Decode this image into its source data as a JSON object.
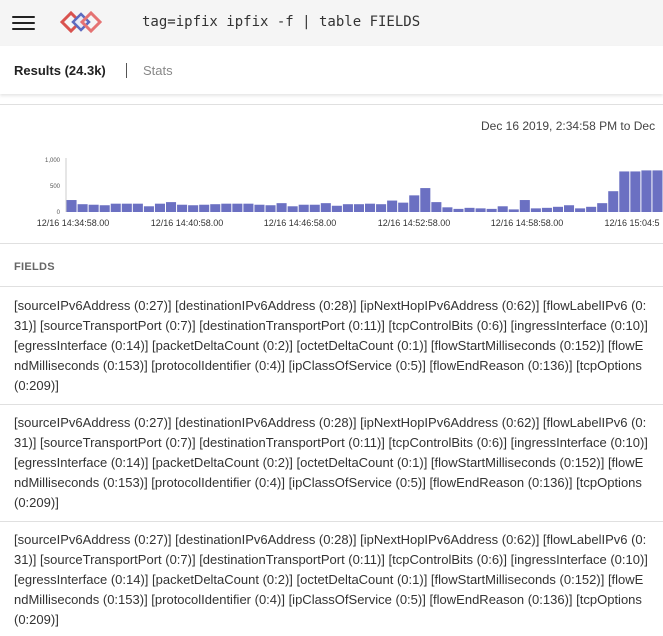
{
  "query": "tag=ipfix ipfix -f | table FIELDS",
  "tabs": {
    "results": "Results (24.3k)",
    "stats": "Stats"
  },
  "histogram": {
    "range_text": "Dec 16 2019, 2:34:58 PM to Dec",
    "y_ticks": [
      "1,000",
      "500",
      "0"
    ],
    "x_labels": [
      "12/16 14:34:58.00",
      "12/16 14:40:58.00",
      "12/16 14:46:58.00",
      "12/16 14:52:58.00",
      "12/16 14:58:58.00",
      "12/16 15:04:5"
    ],
    "bar_color": "#6b70c2"
  },
  "chart_data": {
    "type": "bar",
    "ylim": [
      0,
      1000
    ],
    "y_ticks": [
      0,
      500,
      1000
    ],
    "values": [
      230,
      150,
      140,
      130,
      160,
      160,
      160,
      110,
      160,
      190,
      140,
      130,
      140,
      150,
      160,
      160,
      160,
      140,
      130,
      170,
      110,
      140,
      140,
      170,
      120,
      150,
      150,
      160,
      150,
      220,
      180,
      320,
      460,
      190,
      90,
      60,
      80,
      70,
      60,
      110,
      50,
      230,
      70,
      80,
      100,
      130,
      70,
      100,
      170,
      400,
      780,
      780,
      800,
      800
    ],
    "x_labels": [
      "12/16 14:34:58.00",
      "12/16 14:40:58.00",
      "12/16 14:46:58.00",
      "12/16 14:52:58.00",
      "12/16 14:58:58.00",
      "12/16 15:04:5"
    ]
  },
  "fields": {
    "header": "FIELDS",
    "rows": [
      "[sourceIPv6Address (0:27)] [destinationIPv6Address (0:28)] [ipNextHopIPv6Address (0:62)] [flowLabelIPv6 (0:31)] [sourceTransportPort (0:7)] [destinationTransportPort (0:11)] [tcpControlBits (0:6)] [ingressInterface (0:10)] [egressInterface (0:14)] [packetDeltaCount (0:2)] [octetDeltaCount (0:1)] [flowStartMilliseconds (0:152)] [flowEndMilliseconds (0:153)] [protocolIdentifier (0:4)] [ipClassOfService (0:5)] [flowEndReason (0:136)] [tcpOptions (0:209)]",
      "[sourceIPv6Address (0:27)] [destinationIPv6Address (0:28)] [ipNextHopIPv6Address (0:62)] [flowLabelIPv6 (0:31)] [sourceTransportPort (0:7)] [destinationTransportPort (0:11)] [tcpControlBits (0:6)] [ingressInterface (0:10)] [egressInterface (0:14)] [packetDeltaCount (0:2)] [octetDeltaCount (0:1)] [flowStartMilliseconds (0:152)] [flowEndMilliseconds (0:153)] [protocolIdentifier (0:4)] [ipClassOfService (0:5)] [flowEndReason (0:136)] [tcpOptions (0:209)]",
      "[sourceIPv6Address (0:27)] [destinationIPv6Address (0:28)] [ipNextHopIPv6Address (0:62)] [flowLabelIPv6 (0:31)] [sourceTransportPort (0:7)] [destinationTransportPort (0:11)] [tcpControlBits (0:6)] [ingressInterface (0:10)] [egressInterface (0:14)] [packetDeltaCount (0:2)] [octetDeltaCount (0:1)] [flowStartMilliseconds (0:152)] [flowEndMilliseconds (0:153)] [protocolIdentifier (0:4)] [ipClassOfService (0:5)] [flowEndReason (0:136)] [tcpOptions (0:209)]"
    ]
  }
}
